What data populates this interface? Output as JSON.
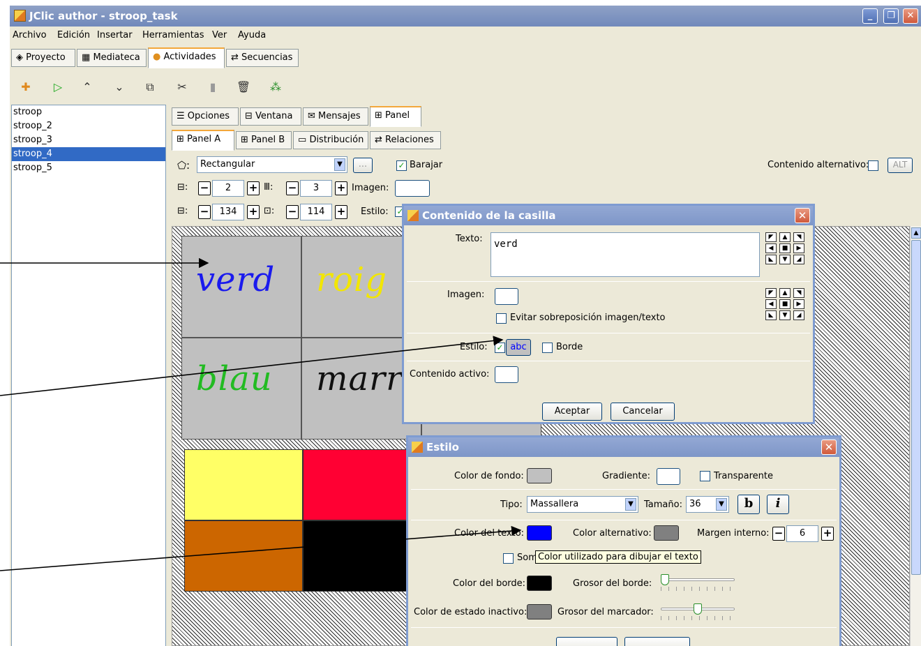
{
  "window": {
    "title": "JClic author - stroop_task"
  },
  "menu": [
    "Archivo",
    "Edición",
    "Insertar",
    "Herramientas",
    "Ver",
    "Ayuda"
  ],
  "main_tabs": [
    "Proyecto",
    "Mediateca",
    "Actividades",
    "Secuencias"
  ],
  "toolbar_icons": [
    "new-activity-icon",
    "play-icon",
    "move-up-icon",
    "move-down-icon",
    "copy-icon",
    "cut-icon",
    "paste-icon",
    "delete-icon",
    "activity-settings-icon"
  ],
  "activities": [
    "stroop",
    "stroop_2",
    "stroop_3",
    "stroop_4",
    "stroop_5"
  ],
  "selected_activity": "stroop_4",
  "activity_tabs": [
    "Opciones",
    "Ventana",
    "Mensajes",
    "Panel"
  ],
  "panel_tabs": [
    "Panel A",
    "Panel B",
    "Distribución",
    "Relaciones"
  ],
  "panel_settings": {
    "shape": "Rectangular",
    "shape_more": "...",
    "shuffle_label": "Barajar",
    "alt_content_label": "Contenido alternativo:",
    "alt_button": "ALT",
    "rows": "2",
    "cols": "3",
    "image_label": "Imagen:",
    "width": "134",
    "height": "114",
    "style_label": "Estilo:"
  },
  "cells_top": [
    "verd",
    "roig",
    "blau",
    "marr"
  ],
  "cell_colors_top": [
    "#1a1aee",
    "#f2e600",
    "#22bb22",
    "#111111"
  ],
  "cells_bottom_colors": [
    "#ffff66",
    "#ff0033",
    "#cc6600",
    "#000000"
  ],
  "dialog_content": {
    "title": "Contenido de la casilla",
    "text_label": "Texto:",
    "text_value": "verd",
    "image_label": "Imagen:",
    "avoid_overlap": "Evitar sobreposición imagen/texto",
    "style_label": "Estilo:",
    "style_sample": "abc",
    "border_label": "Borde",
    "active_content_label": "Contenido activo:",
    "ok": "Aceptar",
    "cancel": "Cancelar"
  },
  "dialog_style": {
    "title": "Estilo",
    "bg_color_label": "Color de fondo:",
    "gradient_label": "Gradiente:",
    "transparent_label": "Transparente",
    "font_label": "Tipo:",
    "font_value": "Massallera",
    "size_label": "Tamaño:",
    "size_value": "36",
    "bold": "b",
    "italic": "i",
    "text_color_label": "Color del texto:",
    "alt_color_label": "Color alternativo:",
    "margin_label": "Margen interno:",
    "margin_value": "6",
    "shadow_label": "Sombra",
    "tooltip": "Color utilizado para dibujar el texto",
    "border_color_label": "Color del borde:",
    "border_width_label": "Grosor del borde:",
    "inactive_color_label": "Color de estado inactivo:",
    "marker_width_label": "Grosor del marcador:",
    "border_width_level": 0.0,
    "marker_width_level": 0.5,
    "colors": {
      "bg": "#c0c0c0",
      "text": "#0000ff",
      "alt": "#808080",
      "border": "#000000",
      "inactive": "#808080"
    }
  }
}
